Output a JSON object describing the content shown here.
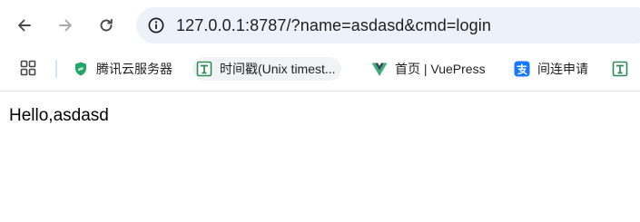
{
  "browser": {
    "url": "127.0.0.1:8787/?name=asdasd&cmd=login",
    "nav": {
      "back_icon": "back-arrow-icon",
      "forward_icon": "forward-arrow-icon",
      "reload_icon": "reload-icon",
      "site_info_icon": "info-circle-icon"
    },
    "bookmarks": [
      {
        "label": "腾讯云服务器",
        "icon": "tencent-cloud-shield-icon",
        "color": "#22a566"
      },
      {
        "label": "时间戳(Unix timest...",
        "icon": "green-t-icon",
        "color": "#2e8b57"
      },
      {
        "label": "首页 | VuePress",
        "icon": "vue-logo-icon",
        "color": "#3eaf7c"
      },
      {
        "label": "间连申请",
        "icon": "alipay-icon",
        "color": "#1677ff"
      },
      {
        "label": "",
        "icon": "green-t-icon",
        "color": "#2e8b57"
      }
    ]
  },
  "page": {
    "body_text": "Hello,asdasd"
  }
}
